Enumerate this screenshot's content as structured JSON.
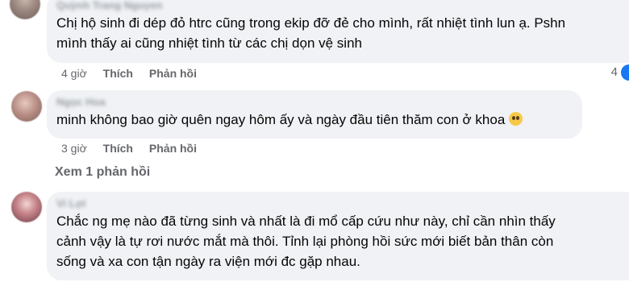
{
  "comments": [
    {
      "author": "Quỳnh Trang Nguyen",
      "text_lines": [
        "Chị hộ sinh đi dép đỏ htrc cũng trong ekip đỡ đẻ cho mình, rất nhiệt tình lun ạ. Pshn",
        "mình thấy ai cũng nhiệt tình từ các chị dọn vệ sinh"
      ],
      "time": "4 giờ",
      "like_label": "Thích",
      "reply_label": "Phản hồi",
      "reaction_count": "4"
    },
    {
      "author": "Ngọc Hoa",
      "text": "minh không bao giờ quên ngay hôm ấy và ngày đầu tiên thăm con ở khoa",
      "emoji": "pleading-face",
      "time": "3 giờ",
      "like_label": "Thích",
      "reply_label": "Phản hồi"
    },
    {
      "author": "Vi Lợi",
      "text_lines": [
        "Chắc ng mẹ nào đã từng sinh và nhất là đi mổ cấp cứu như này, chỉ cần nhìn thấy",
        "cảnh vậy là tự rơi nước mắt mà thôi. Tỉnh lại phòng hồi sức mới biết bản thân còn",
        "sống và xa con tận ngày ra viện mới đc gặp nhau."
      ]
    }
  ],
  "view_replies_label": "Xem 1 phản hồi",
  "colors": {
    "bubble_bg": "#f0f2f5",
    "secondary_text": "#65676b",
    "reaction_blue": "#1877f2"
  }
}
